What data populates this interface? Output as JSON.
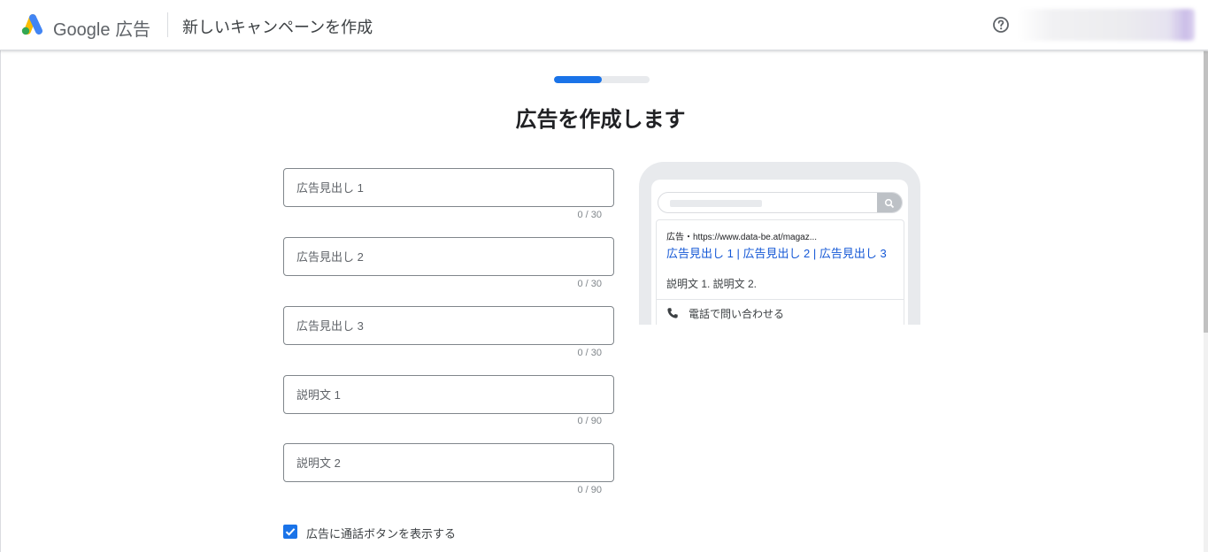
{
  "header": {
    "brand_google": "Google",
    "brand_product": "広告",
    "page_heading": "新しいキャンペーンを作成",
    "help_icon": "help-circle-icon",
    "logo_icon": "google-ads-logo-icon"
  },
  "progress": {
    "value": 0.5,
    "color": "#1a73e8"
  },
  "main": {
    "title": "広告を作成します"
  },
  "fields": {
    "headline1": {
      "placeholder": "広告見出し 1",
      "value": "",
      "counter": "0 / 30"
    },
    "headline2": {
      "placeholder": "広告見出し 2",
      "value": "",
      "counter": "0 / 30"
    },
    "headline3": {
      "placeholder": "広告見出し 3",
      "value": "",
      "counter": "0 / 30"
    },
    "description1": {
      "placeholder": "説明文 1",
      "value": "",
      "counter": "0 / 90"
    },
    "description2": {
      "placeholder": "説明文 2",
      "value": "",
      "counter": "0 / 90"
    }
  },
  "call_button": {
    "label": "広告に通話ボタンを表示する",
    "checked": true
  },
  "preview": {
    "ad_meta": "広告・https://www.data-be.at/magaz...",
    "headline": "広告見出し 1 | 広告見出し 2 | 広告見出し 3",
    "description": "説明文 1. 説明文 2.",
    "call_text": "電話で問い合わせる",
    "search_icon": "search-icon",
    "phone_icon": "phone-icon"
  },
  "colors": {
    "accent": "#1a73e8",
    "link": "#1558d6"
  }
}
